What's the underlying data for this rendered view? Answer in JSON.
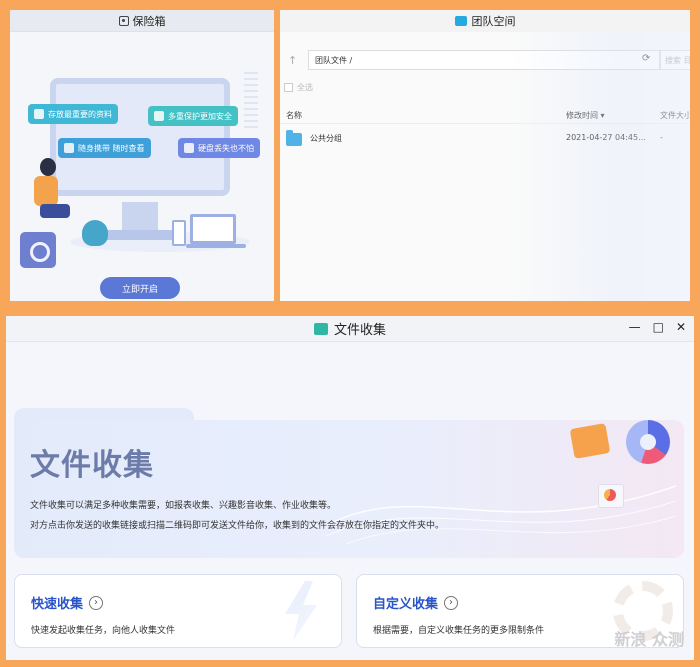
{
  "colors": {
    "frame": "#f8a65a",
    "accent_blue": "#2a55c8",
    "primary_button": "#5b78d7",
    "team_icon": "#26a8e0",
    "collect_icon": "#2fb7a4"
  },
  "safe": {
    "title": "保险箱",
    "title_icon": "safe-icon",
    "features": [
      "存放最重要的资料",
      "多重保护更加安全",
      "随身携带 随时查看",
      "硬盘丢失也不怕"
    ],
    "start_button": "立即开启"
  },
  "team": {
    "title": "团队空间",
    "title_icon": "team-space-icon",
    "path": "团队文件 /",
    "search_placeholder": "搜索 目",
    "select_all": "全选",
    "columns": {
      "name": "名称",
      "modified": "修改时间 ▾",
      "size": "文件大小"
    },
    "rows": [
      {
        "name": "公共分组",
        "modified": "2021-04-27 04:45...",
        "size": "-"
      }
    ]
  },
  "collect": {
    "title": "文件收集",
    "title_icon": "file-collect-icon",
    "window_controls": {
      "minimize": "—",
      "maximize": "□",
      "close": "✕"
    },
    "hero": {
      "heading": "文件收集",
      "desc1": "文件收集可以满足多种收集需要，如报表收集、兴趣影音收集、作业收集等。",
      "desc2": "对方点击你发送的收集链接或扫描二维码即可发送文件给你，收集到的文件会存放在你指定的文件夹中。"
    },
    "cards": [
      {
        "title": "快速收集",
        "desc": "快速发起收集任务，向他人收集文件"
      },
      {
        "title": "自定义收集",
        "desc": "根据需要，自定义收集任务的更多限制条件"
      }
    ],
    "watermark": "新浪 众测"
  }
}
